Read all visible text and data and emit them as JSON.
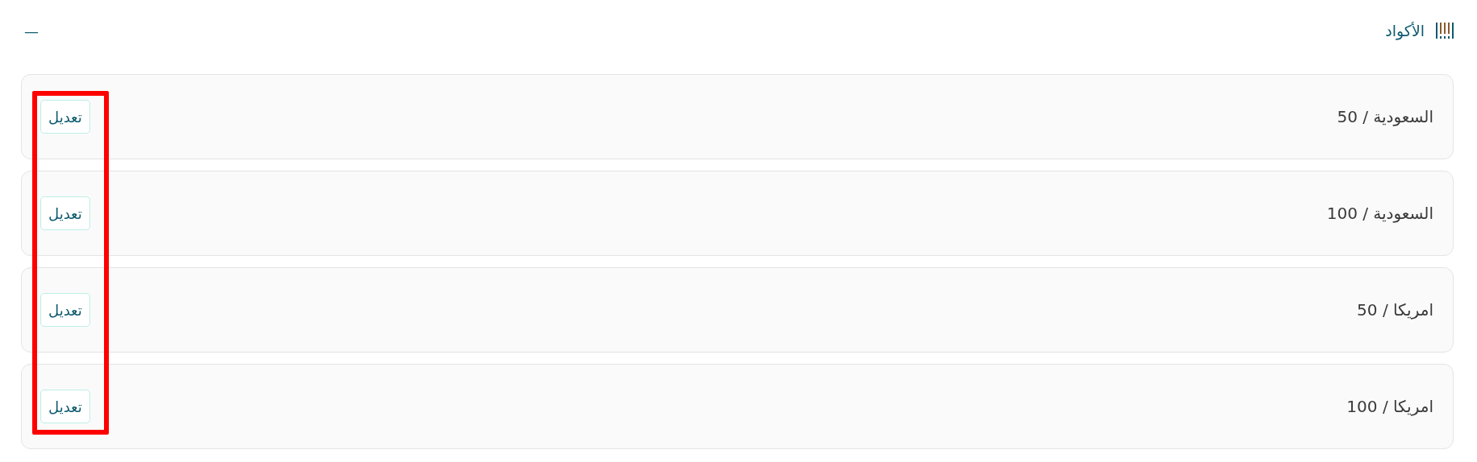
{
  "header": {
    "title": "الأكواد",
    "collapse_symbol": "—"
  },
  "codes": [
    {
      "label": "السعودية / 50",
      "action": "تعديل"
    },
    {
      "label": "السعودية / 100",
      "action": "تعديل"
    },
    {
      "label": "امريكا / 50",
      "action": "تعديل"
    },
    {
      "label": "امريكا / 100",
      "action": "تعديل"
    }
  ],
  "annotation": {
    "kind": "box"
  }
}
